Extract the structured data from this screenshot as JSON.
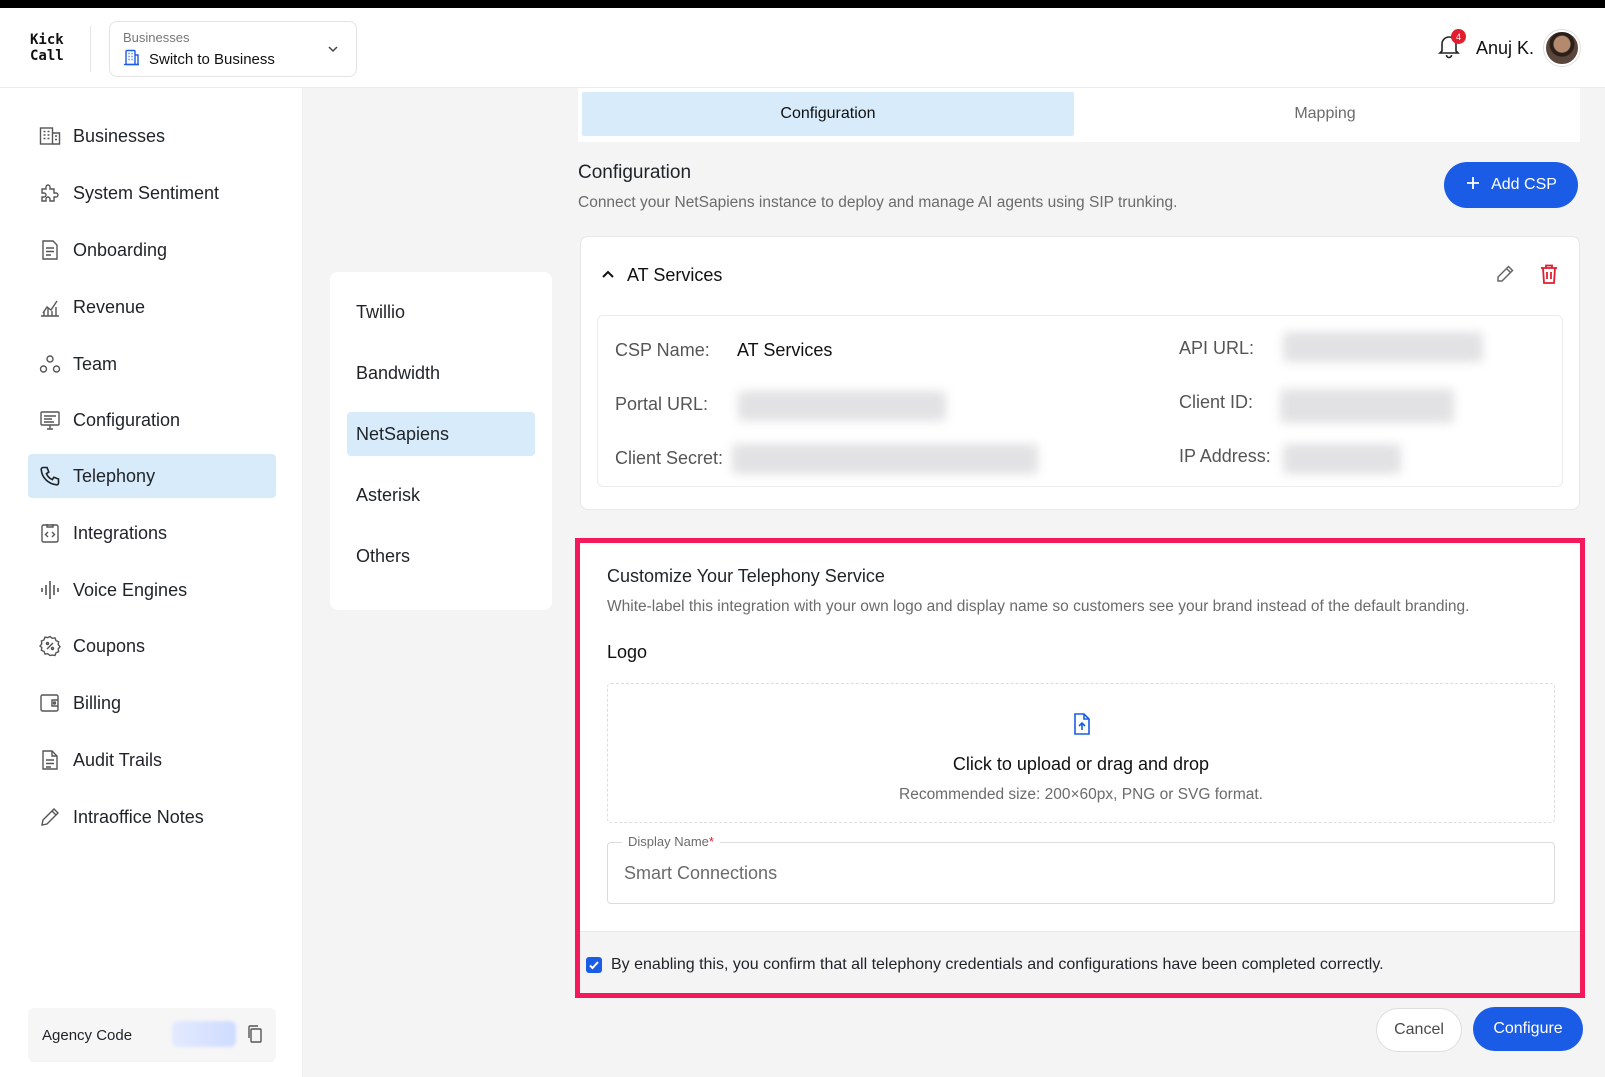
{
  "brand": {
    "logo_line1": "Kick",
    "logo_line2": "Call"
  },
  "business_switcher": {
    "caption": "Businesses",
    "label": "Switch to Business"
  },
  "header": {
    "notification_count": "4",
    "user_name": "Anuj K."
  },
  "sidebar": {
    "items": [
      {
        "label": "Businesses",
        "icon": "building-icon"
      },
      {
        "label": "System Sentiment",
        "icon": "puzzle-icon"
      },
      {
        "label": "Onboarding",
        "icon": "document-icon"
      },
      {
        "label": "Revenue",
        "icon": "chart-icon"
      },
      {
        "label": "Team",
        "icon": "team-icon"
      },
      {
        "label": "Configuration",
        "icon": "monitor-icon"
      },
      {
        "label": "Telephony",
        "icon": "phone-icon"
      },
      {
        "label": "Integrations",
        "icon": "code-clipboard-icon"
      },
      {
        "label": "Voice Engines",
        "icon": "waveform-icon"
      },
      {
        "label": "Coupons",
        "icon": "coupon-icon"
      },
      {
        "label": "Billing",
        "icon": "wallet-icon"
      },
      {
        "label": "Audit Trails",
        "icon": "file-icon"
      },
      {
        "label": "Intraoffice Notes",
        "icon": "pencil-icon"
      }
    ],
    "active": "Telephony",
    "agency_label": "Agency Code"
  },
  "providers": {
    "items": [
      "Twillio",
      "Bandwidth",
      "NetSapiens",
      "Asterisk",
      "Others"
    ],
    "active": "NetSapiens"
  },
  "tabs": {
    "configuration": "Configuration",
    "mapping": "Mapping",
    "active": "Configuration"
  },
  "configuration": {
    "title": "Configuration",
    "subtitle": "Connect your NetSapiens instance to deploy and manage AI agents using SIP trunking.",
    "add_button": "Add CSP"
  },
  "csp": {
    "header": "AT Services",
    "csp_name_label": "CSP Name:",
    "csp_name_value": "AT Services",
    "portal_url_label": "Portal URL:",
    "client_secret_label": "Client Secret:",
    "api_url_label": "API URL:",
    "client_id_label": "Client ID:",
    "ip_address_label": "IP Address:"
  },
  "customize": {
    "title": "Customize Your Telephony Service",
    "subtitle": "White-label this integration with your own logo and display name so customers see your brand instead of the default branding.",
    "logo_label": "Logo",
    "upload_text": "Click to upload or drag and drop",
    "upload_hint": "Recommended size: 200×60px, PNG or SVG format.",
    "display_name_label": "Display Name",
    "display_name_required": "*",
    "display_name_value": "Smart Connections",
    "confirm_text": "By enabling this, you confirm that all telephony credentials and configurations have been completed correctly.",
    "confirm_checked": true
  },
  "actions": {
    "cancel": "Cancel",
    "configure": "Configure"
  },
  "colors": {
    "accent": "#1b5ce6",
    "active_bg": "#d7ebfb",
    "highlight_border": "#f3195a",
    "danger": "#e11d2e"
  }
}
